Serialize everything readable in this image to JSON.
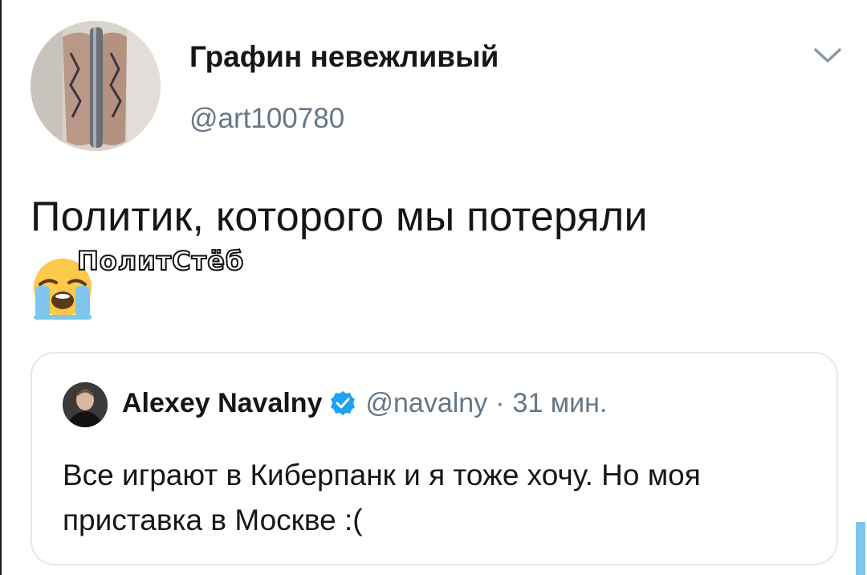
{
  "tweet": {
    "author": {
      "display_name": "Графин невежливый",
      "handle": "@art100780"
    },
    "text": "Политик, которого мы потеряли",
    "emoji": "loudly-crying-face",
    "menu_icon": "chevron-down-icon"
  },
  "watermark": {
    "text": "ПолитСтёб"
  },
  "quoted_tweet": {
    "author": {
      "display_name": "Alexey Navalny",
      "handle": "@navalny",
      "verified": true
    },
    "separator": "·",
    "time": "31 мин.",
    "text": "Все играют в Киберпанк и я тоже хочу. Но моя приставка в Москве :("
  },
  "colors": {
    "text_primary": "#14171a",
    "text_secondary": "#657786",
    "verified_blue": "#1da1f2",
    "card_border": "#e1e8ed"
  }
}
